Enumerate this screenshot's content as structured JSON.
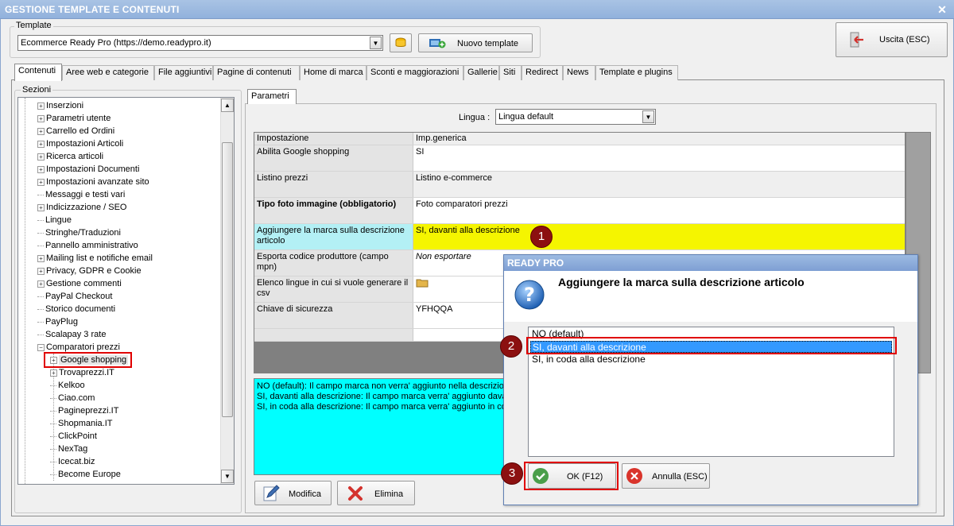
{
  "window": {
    "title": "GESTIONE TEMPLATE E CONTENUTI",
    "close": "✕"
  },
  "template_group": {
    "label": "Template",
    "selected": "Ecommerce Ready Pro (https://demo.readypro.it)",
    "new_button": "Nuovo template"
  },
  "exit_button": "Uscita (ESC)",
  "tabs": [
    "Contenuti",
    "Aree web e categorie",
    "File aggiuntivi",
    "Pagine di contenuti",
    "Home di marca",
    "Sconti e maggiorazioni",
    "Gallerie",
    "Siti",
    "Redirect",
    "News",
    "Template e plugins"
  ],
  "sections": {
    "label": "Sezioni",
    "items": [
      {
        "label": "Inserzioni",
        "level": 1,
        "expandable": true
      },
      {
        "label": "Parametri utente",
        "level": 1,
        "expandable": true
      },
      {
        "label": "Carrello ed Ordini",
        "level": 1,
        "expandable": true
      },
      {
        "label": "Impostazioni Articoli",
        "level": 1,
        "expandable": true
      },
      {
        "label": "Ricerca articoli",
        "level": 1,
        "expandable": true
      },
      {
        "label": "Impostazioni Documenti",
        "level": 1,
        "expandable": true
      },
      {
        "label": "Impostazioni avanzate sito",
        "level": 1,
        "expandable": true
      },
      {
        "label": "Messaggi e testi vari",
        "level": 1,
        "expandable": false
      },
      {
        "label": "Indicizzazione / SEO",
        "level": 1,
        "expandable": true
      },
      {
        "label": "Lingue",
        "level": 1,
        "expandable": false
      },
      {
        "label": "Stringhe/Traduzioni",
        "level": 1,
        "expandable": false
      },
      {
        "label": "Pannello amministrativo",
        "level": 1,
        "expandable": false
      },
      {
        "label": "Mailing list e notifiche email",
        "level": 1,
        "expandable": true
      },
      {
        "label": "Privacy, GDPR e Cookie",
        "level": 1,
        "expandable": true
      },
      {
        "label": "Gestione commenti",
        "level": 1,
        "expandable": true
      },
      {
        "label": "PayPal Checkout",
        "level": 1,
        "expandable": false
      },
      {
        "label": "Storico documenti",
        "level": 1,
        "expandable": false
      },
      {
        "label": "PayPlug",
        "level": 1,
        "expandable": false
      },
      {
        "label": "Scalapay 3 rate",
        "level": 1,
        "expandable": false
      },
      {
        "label": "Comparatori prezzi",
        "level": 1,
        "expandable": true,
        "expanded": true
      },
      {
        "label": "Google shopping",
        "level": 2,
        "expandable": true,
        "selected": true
      },
      {
        "label": "Trovaprezzi.IT",
        "level": 2,
        "expandable": true
      },
      {
        "label": "Kelkoo",
        "level": 2,
        "expandable": false
      },
      {
        "label": "Ciao.com",
        "level": 2,
        "expandable": false
      },
      {
        "label": "Pagineprezzi.IT",
        "level": 2,
        "expandable": false
      },
      {
        "label": "Shopmania.IT",
        "level": 2,
        "expandable": false
      },
      {
        "label": "ClickPoint",
        "level": 2,
        "expandable": false
      },
      {
        "label": "NexTag",
        "level": 2,
        "expandable": false
      },
      {
        "label": "Icecat.biz",
        "level": 2,
        "expandable": false
      },
      {
        "label": "Become Europe",
        "level": 2,
        "expandable": false
      }
    ]
  },
  "params": {
    "tab": "Parametri",
    "language_label": "Lingua :",
    "language_value": "Lingua default",
    "header": {
      "setting": "Impostazione",
      "value": "Imp.generica"
    },
    "rows": [
      {
        "setting": "Abilita Google shopping",
        "value": "SI"
      },
      {
        "setting": "Listino prezzi",
        "value": "Listino e-commerce"
      },
      {
        "setting": "Tipo foto immagine (obbligatorio)",
        "value": "Foto comparatori prezzi"
      },
      {
        "setting": "Aggiungere la marca sulla descrizione articolo",
        "value": "SI, davanti alla descrizione"
      },
      {
        "setting": "Esporta codice produttore (campo mpn)",
        "value": "Non esportare"
      },
      {
        "setting": "Elenco lingue in cui si vuole generare il csv",
        "value": ""
      },
      {
        "setting": "Chiave di sicurezza",
        "value": "YFHQQA"
      }
    ],
    "description_lines": [
      "NO (default): Il campo marca non verra' aggiunto nella descrizione",
      "SI, davanti alla descrizione: Il campo marca verra' aggiunto davanti",
      "SI, in coda alla descrizione: Il campo marca verra' aggiunto in coda"
    ],
    "edit_button": "Modifica",
    "delete_button": "Elimina"
  },
  "dialog": {
    "title": "READY PRO",
    "question": "Aggiungere la marca sulla descrizione articolo",
    "options": [
      "NO (default)",
      "SI, davanti alla descrizione",
      "SI, in coda alla descrizione"
    ],
    "selected_index": 1,
    "ok_button": "OK (F12)",
    "cancel_button": "Annulla (ESC)"
  },
  "steps": [
    "1",
    "2",
    "3"
  ],
  "colors": {
    "highlight_row": "#f5f500",
    "selected_row": "#b3f0f5",
    "description_bg": "#00ffff",
    "selection": "#3399ff",
    "step_badge": "#8c1010",
    "callout_border": "#e00000"
  }
}
